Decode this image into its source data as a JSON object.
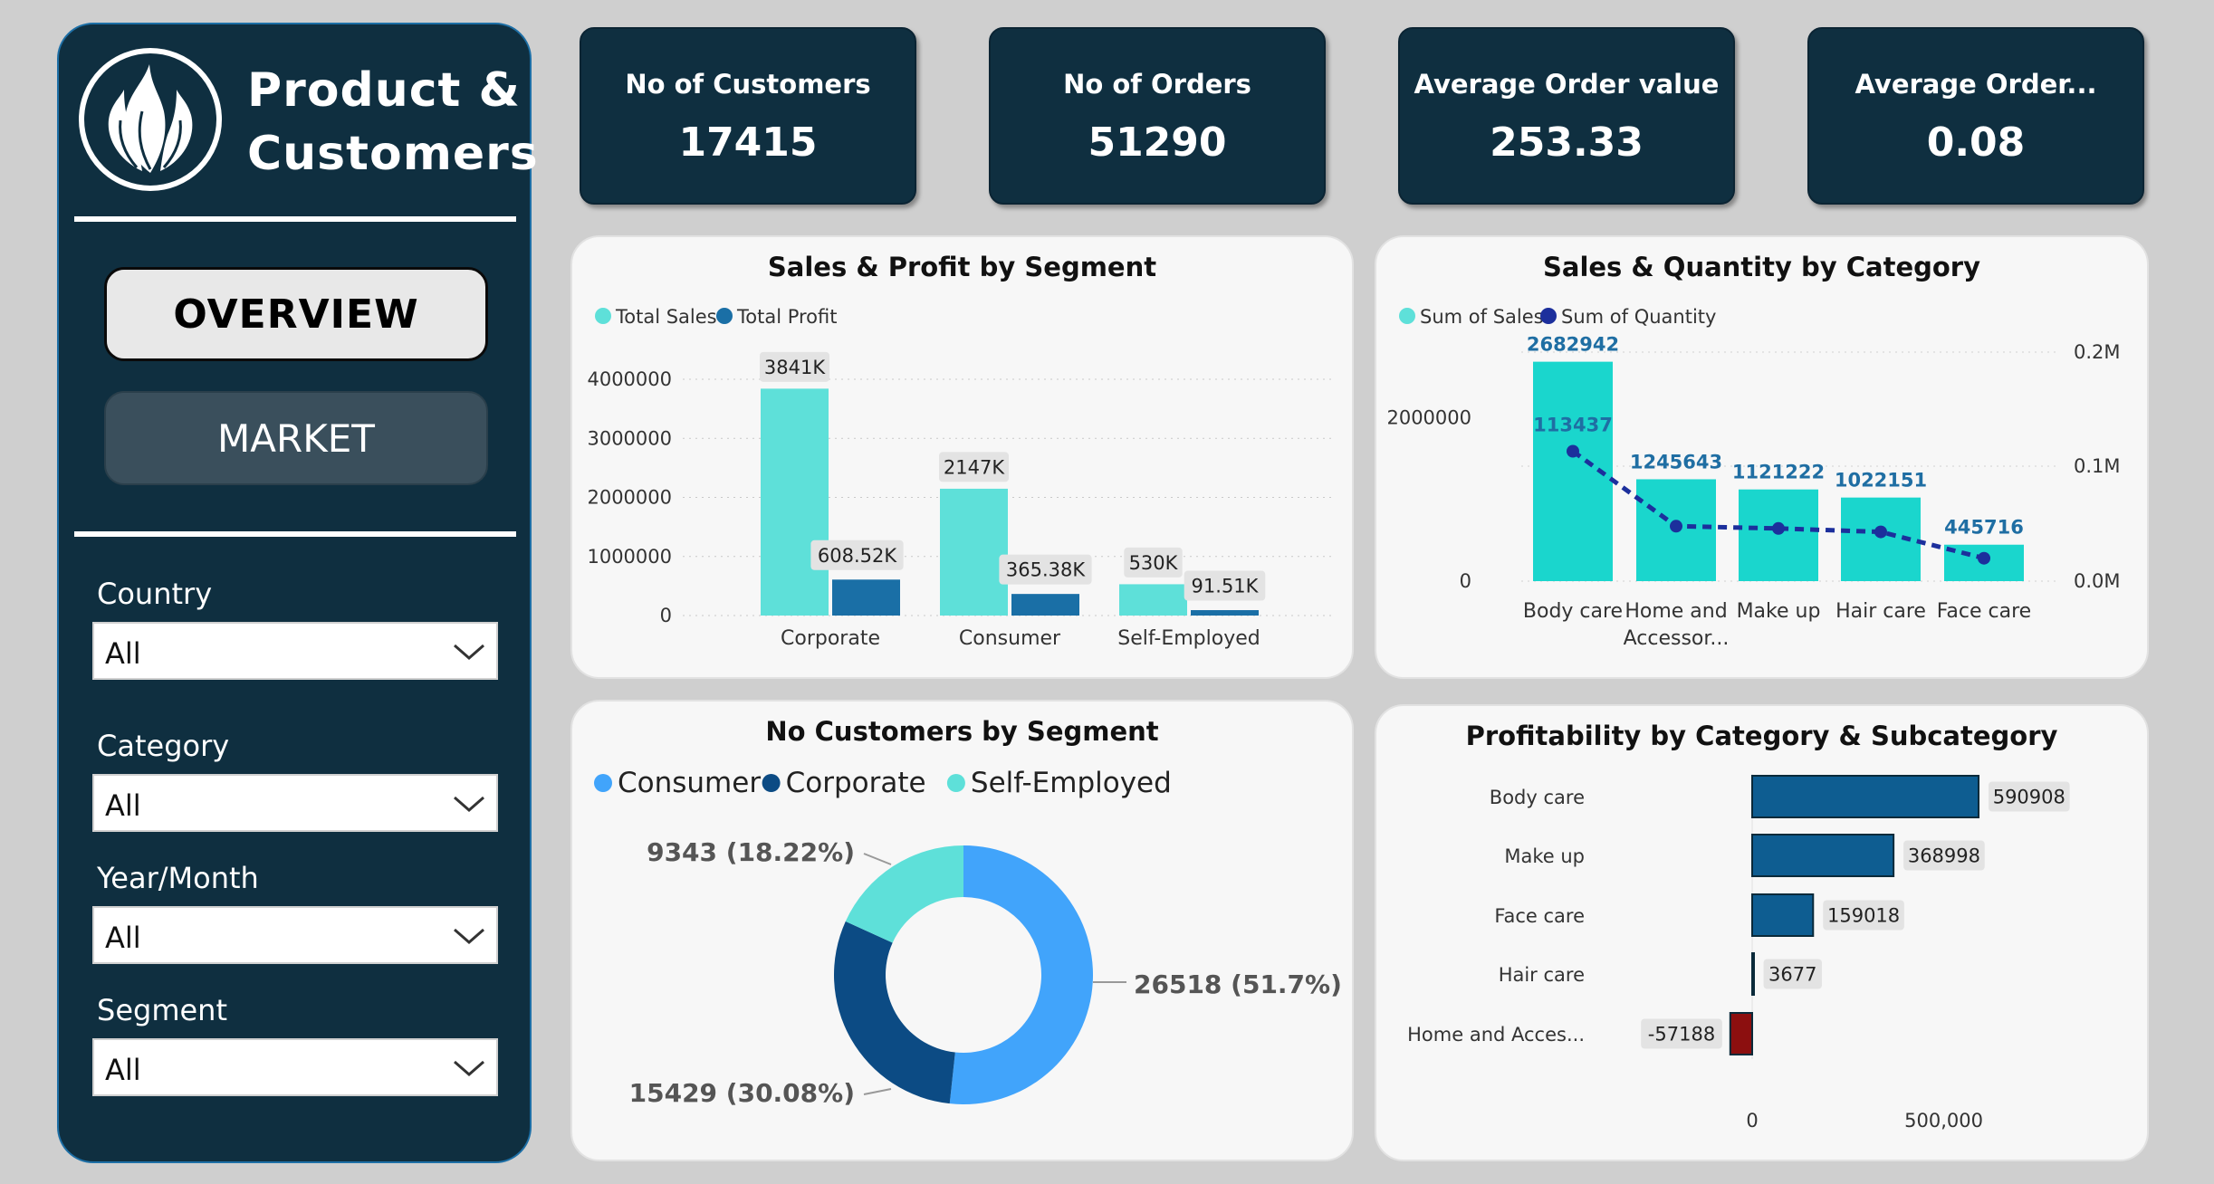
{
  "sidebar": {
    "brand_line1": "Product &",
    "brand_line2": "Customers",
    "nav": {
      "overview": "OVERVIEW",
      "market": "MARKET"
    },
    "filters": [
      {
        "label": "Country",
        "value": "All"
      },
      {
        "label": "Category",
        "value": "All"
      },
      {
        "label": "Year/Month",
        "value": "All"
      },
      {
        "label": "Segment",
        "value": "All"
      }
    ]
  },
  "kpis": [
    {
      "title": "No of Customers",
      "value": "17415"
    },
    {
      "title": "No of Orders",
      "value": "51290"
    },
    {
      "title": "Average Order value",
      "value": "253.33"
    },
    {
      "title": "Average Order...",
      "value": "0.08"
    }
  ],
  "colors": {
    "navy": "#0f2f40",
    "sales": "#5ee0d9",
    "profit": "#1a6fa6",
    "quantity": "#1c2f9c",
    "consumer": "#41a4fb",
    "corporate": "#0c4b84",
    "self_employed": "#5ee0d9",
    "profit_bar": "#0e5d91",
    "loss_bar": "#8c0f0f"
  },
  "chart_data": [
    {
      "id": "seg",
      "type": "bar",
      "title": "Sales & Profit by Segment",
      "categories": [
        "Corporate",
        "Consumer",
        "Self-Employed"
      ],
      "series": [
        {
          "name": "Total Sales",
          "values": [
            3841000,
            2147000,
            530000
          ],
          "labels": [
            "3841K",
            "2147K",
            "530K"
          ]
        },
        {
          "name": "Total Profit",
          "values": [
            608520,
            365380,
            91510
          ],
          "labels": [
            "608.52K",
            "365.38K",
            "91.51K"
          ]
        }
      ],
      "yticks": [
        "4000000",
        "3000000",
        "2000000",
        "1000000",
        "0"
      ],
      "ylim": [
        0,
        4000000
      ],
      "legend": "top-left"
    },
    {
      "id": "cat",
      "type": "bar",
      "title": "Sales & Quantity by Category",
      "categories": [
        "Body care",
        "Home and Accessor...",
        "Make up",
        "Hair care",
        "Face care"
      ],
      "category_lines": [
        [
          "Body care"
        ],
        [
          "Home and",
          "Accessor..."
        ],
        [
          "Make up"
        ],
        [
          "Hair care"
        ],
        [
          "Face care"
        ]
      ],
      "series": [
        {
          "name": "Sum of Sales",
          "values": [
            2682942,
            1245643,
            1121222,
            1022151,
            445716
          ],
          "labels": [
            "2682942",
            "1245643",
            "1121222",
            "1022151",
            "445716"
          ]
        },
        {
          "name": "Sum of Quantity",
          "type": "line",
          "values": [
            113437,
            48000,
            46000,
            43000,
            20000
          ],
          "labels": [
            "113437",
            "",
            "",
            "",
            ""
          ]
        }
      ],
      "yticks_left": [
        "2000000",
        "0"
      ],
      "yticks_right": [
        "0.2M",
        "0.1M",
        "0.0M"
      ],
      "ylim_left": [
        0,
        2900000
      ],
      "ylim_right": [
        0,
        200000
      ],
      "legend": "top-left"
    },
    {
      "id": "donut",
      "type": "pie",
      "title": "No Customers by Segment",
      "slices": [
        {
          "name": "Consumer",
          "value": 26518,
          "label": "26518 (51.7%)"
        },
        {
          "name": "Corporate",
          "value": 15429,
          "label": "15429 (30.08%)"
        },
        {
          "name": "Self-Employed",
          "value": 9343,
          "label": "9343 (18.22%)"
        }
      ],
      "legend": "top-left"
    },
    {
      "id": "profit",
      "type": "bar",
      "orientation": "horizontal",
      "title": "Profitability by Category & Subcategory",
      "categories": [
        "Body care",
        "Make up",
        "Face care",
        "Hair care",
        "Home and Acces..."
      ],
      "values": [
        590908,
        368998,
        159018,
        3677,
        -57188
      ],
      "labels": [
        "590908",
        "368998",
        "159018",
        "3677",
        "-57188"
      ],
      "xticks": [
        "0",
        "500,000"
      ],
      "xlim": [
        -60000,
        600000
      ]
    }
  ]
}
